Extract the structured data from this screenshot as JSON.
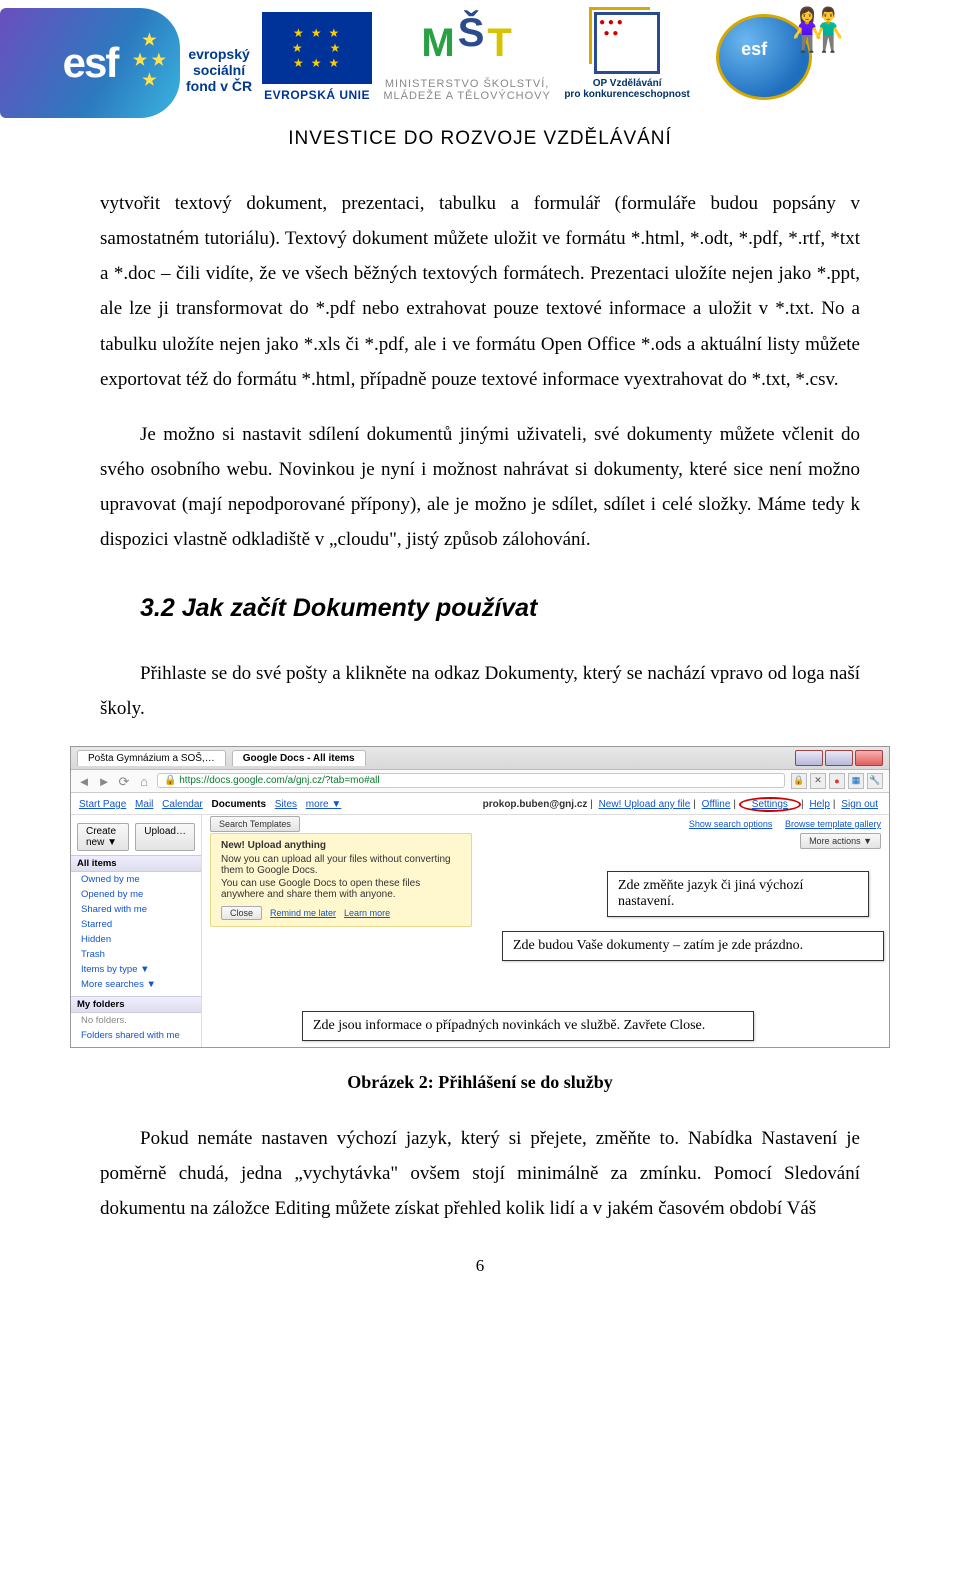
{
  "header": {
    "esf_text": "esf",
    "esf_label_line1": "evropský",
    "esf_label_line2": "sociální",
    "esf_label_line3": "fond v ČR",
    "eu_label": "EVROPSKÁ UNIE",
    "msmt_line1": "MINISTERSTVO ŠKOLSTVÍ,",
    "msmt_line2": "MLÁDEŽE A TĚLOVÝCHOVY",
    "opv_line1": "OP Vzdělávání",
    "opv_line2": "pro konkurenceschopnost",
    "globe_text": "esf",
    "caption": "INVESTICE DO ROZVOJE  VZDĚLÁVÁNÍ"
  },
  "body": {
    "p1": "vytvořit textový dokument, prezentaci, tabulku a formulář (formuláře budou popsány v samostatném tutoriálu). Textový dokument můžete uložit ve formátu *.html, *.odt, *.pdf, *.rtf, *txt a *.doc – čili vidíte, že ve všech běžných textových formátech. Prezentaci uložíte nejen jako *.ppt, ale lze ji transformovat do *.pdf nebo extrahovat pouze textové informace a uložit v *.txt. No a tabulku uložíte nejen jako *.xls či *.pdf, ale i ve formátu Open Office *.ods a aktuální listy můžete exportovat též do formátu *.html, případně pouze textové informace vyextrahovat do *.txt, *.csv.",
    "p2": "Je možno si nastavit sdílení dokumentů jinými uživateli, své dokumenty můžete včlenit do svého osobního webu. Novinkou je nyní i možnost nahrávat si dokumenty, které sice není možno upravovat (mají nepodporované přípony), ale je možno je sdílet, sdílet i celé složky. Máme tedy k dispozici vlastně odkladiště v „cloudu\", jistý způsob zálohování.",
    "h2": "3.2 Jak začít Dokumenty používat",
    "p3": "Přihlaste se do své pošty a klikněte na odkaz Dokumenty, který se nachází vpravo od loga naší školy.",
    "p4": "Pokud nemáte nastaven výchozí jazyk, který si přejete, změňte to. Nabídka Nastavení je poměrně chudá, jedna „vychytávka\" ovšem stojí minimálně za zmínku. Pomocí Sledování dokumentu na záložce Editing můžete získat přehled kolik lidí a v jakém časovém období Váš"
  },
  "screenshot": {
    "tab1": "Pošta Gymnázium a SOŠ,…",
    "tab2": "Google Docs - All items",
    "url": "https://docs.google.com/a/gnj.cz/?tab=mo#all",
    "nav_links": [
      "Start Page",
      "Mail",
      "Calendar",
      "Documents",
      "Sites",
      "more ▼"
    ],
    "account_email": "prokop.buben@gnj.cz",
    "account_links": [
      "New! Upload any file",
      "Offline",
      "Settings",
      "Help",
      "Sign out"
    ],
    "settings_circled": "Settings",
    "sidebar": {
      "create_btn": "Create new ▼",
      "upload_btn": "Upload…",
      "all_items": "All items",
      "items": [
        "Owned by me",
        "Opened by me",
        "Shared with me",
        "Starred",
        "Hidden",
        "Trash",
        "Items by type ▼",
        "More searches ▼"
      ],
      "my_folders": "My folders",
      "no_folders": "No folders.",
      "folders_shared": "Folders shared with me"
    },
    "yellow_box": {
      "title": "New! Upload anything",
      "line1": "Now you can upload all your files without converting them to Google Docs.",
      "line2": "You can use Google Docs to open these files anywhere and share them with anyone.",
      "close_btn": "Close",
      "remind": "Remind me later",
      "learn": "Learn more"
    },
    "main_links": {
      "search_templates": "Search Templates",
      "show_search": "Show search options",
      "browse_gallery": "Browse template gallery",
      "more_actions": "More actions ▼"
    },
    "callouts": {
      "c1": "Zde změňte jazyk či jiná výchozí nastavení.",
      "c2": "Zde budou Vaše dokumenty – zatím je zde prázdno.",
      "c3": "Zde jsou informace o případných novinkách ve službě. Zavřete  Close."
    }
  },
  "figure_caption": "Obrázek 2: Přihlášení se do služby",
  "page_number": "6"
}
